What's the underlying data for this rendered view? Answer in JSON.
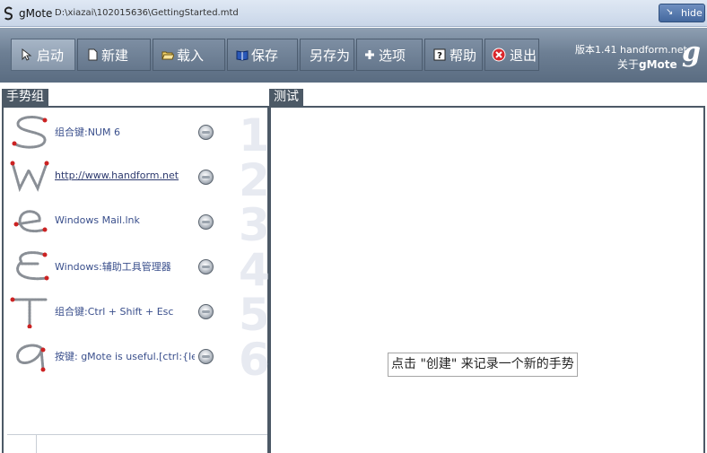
{
  "titlebar": {
    "app_name": "gMote",
    "doc_path": "D:\\xiazai\\102015636\\GettingStarted.mtd",
    "hide_label": "hide"
  },
  "toolbar": {
    "buttons": [
      {
        "label": "启动",
        "icon": "cursor-icon"
      },
      {
        "label": "新建",
        "icon": "new-document-icon"
      },
      {
        "label": "载入",
        "icon": "open-folder-icon"
      },
      {
        "label": "保存",
        "icon": "book-icon"
      },
      {
        "label": "另存为",
        "icon": ""
      },
      {
        "label": "选项",
        "icon": "plus-icon"
      },
      {
        "label": "帮助",
        "icon": "help-icon"
      },
      {
        "label": "退出",
        "icon": "exit-icon"
      }
    ],
    "version_text": "版本1.41 handform.net",
    "about_prefix": "关于",
    "about_name": "gMote",
    "logo": "g"
  },
  "gesture_group": {
    "title": "手势组",
    "items": [
      {
        "glyph": "S",
        "action": "组合键:NUM 6",
        "number": "1",
        "is_link": false
      },
      {
        "glyph": "W",
        "action": "http://www.handform.net",
        "number": "2",
        "is_link": true
      },
      {
        "glyph": "e",
        "action": "Windows Mail.lnk",
        "number": "3",
        "is_link": false
      },
      {
        "glyph": "E",
        "action": "Windows:辅助工具管理器",
        "number": "4",
        "is_link": false
      },
      {
        "glyph": "T",
        "action": "组合键:Ctrl + Shift + Esc",
        "number": "5",
        "is_link": false
      },
      {
        "glyph": "a",
        "action": "按键: gMote is useful.[ctrl:{left}",
        "number": "6",
        "is_link": false
      }
    ]
  },
  "test_panel": {
    "title": "测试",
    "hint": "点击 \"创建\" 来记录一个新的手势"
  },
  "colors": {
    "toolbar": "#6d7f94",
    "panel_border": "#4c5966",
    "hide_button": "#44689e",
    "gesture_stroke": "#8a8f96",
    "gesture_dot": "#cc2222"
  }
}
